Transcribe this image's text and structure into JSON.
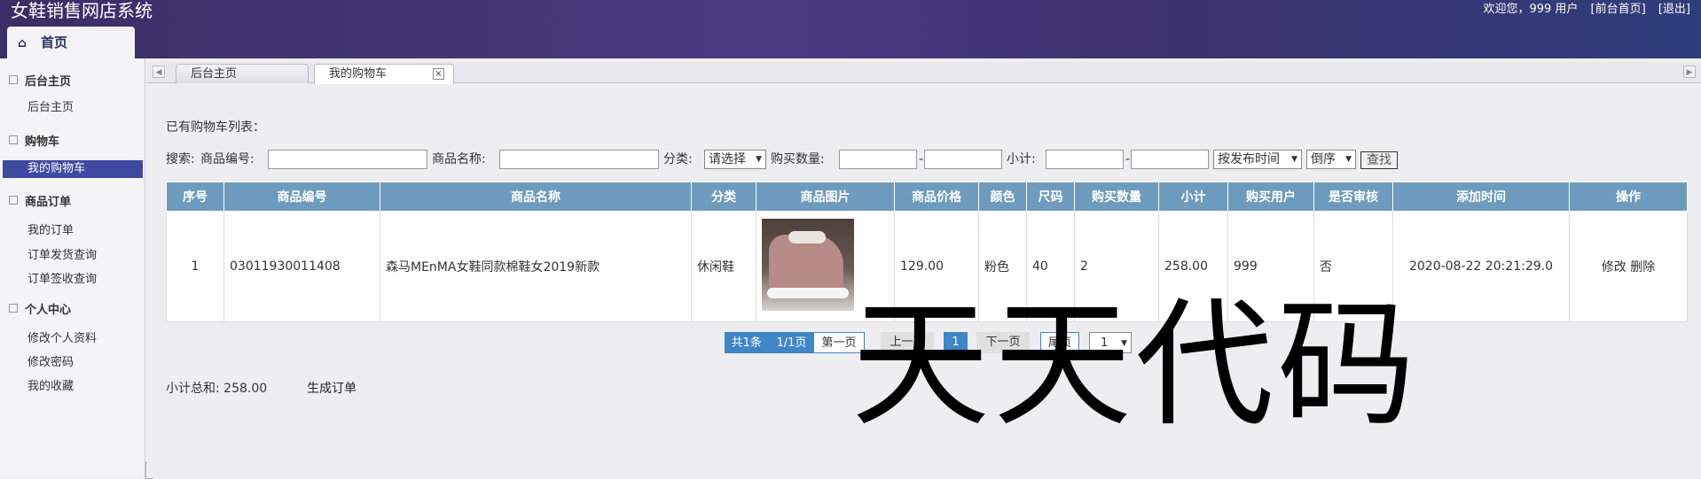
{
  "app": {
    "title": "女鞋销售网店系统"
  },
  "top_links": {
    "welcome": "欢迎您，999 用户",
    "front_home": "[前台首页]",
    "logout": "[退出]"
  },
  "home_tab": {
    "label": "首页"
  },
  "sidebar": {
    "groups": [
      {
        "label": "后台主页",
        "items": [
          "后台主页"
        ]
      },
      {
        "label": "购物车",
        "items": [
          "我的购物车"
        ]
      },
      {
        "label": "商品订单",
        "items": [
          "我的订单",
          "订单发货查询",
          "订单签收查询"
        ]
      },
      {
        "label": "个人中心",
        "items": [
          "修改个人资料",
          "修改密码",
          "我的收藏"
        ]
      }
    ],
    "active_item": "我的购物车"
  },
  "tabs": [
    {
      "label": "后台主页",
      "active": false
    },
    {
      "label": "我的购物车",
      "active": true,
      "close": "×"
    }
  ],
  "page": {
    "list_title": "已有购物车列表："
  },
  "search": {
    "prefix": "搜索:",
    "code_label": "商品编号:",
    "name_label": "商品名称:",
    "category_label": "分类:",
    "category_value": "请选择",
    "qty_label": "购买数量:",
    "subtotal_label": "小计:",
    "dash": "-",
    "sort_by": "按发布时间",
    "order": "倒序",
    "search_button": "查找"
  },
  "table": {
    "columns": [
      "序号",
      "商品编号",
      "商品名称",
      "分类",
      "商品图片",
      "商品价格",
      "颜色",
      "尺码",
      "购买数量",
      "小计",
      "购买用户",
      "是否审核",
      "添加时间",
      "操作"
    ],
    "rows": [
      {
        "index": "1",
        "code": "03011930011408",
        "name": "森马MEnMA女鞋同款棉鞋女2019新款",
        "category": "休闲鞋",
        "price": "129.00",
        "color": "粉色",
        "size": "40",
        "qty": "2",
        "subtotal": "258.00",
        "user": "999",
        "audited": "否",
        "added": "2020-08-22 20:21:29.0",
        "edit": "修改",
        "delete": "删除"
      }
    ]
  },
  "pager": {
    "total": "共1条",
    "pages": "1/1页",
    "first": "第一页",
    "prev": "上一页",
    "current": "1",
    "next": "下一页",
    "last": "尾页",
    "jump_value": "1"
  },
  "summary": {
    "text": "小计总和: 258.00",
    "generate_order": "生成订单"
  },
  "watermark": "天天代码"
}
